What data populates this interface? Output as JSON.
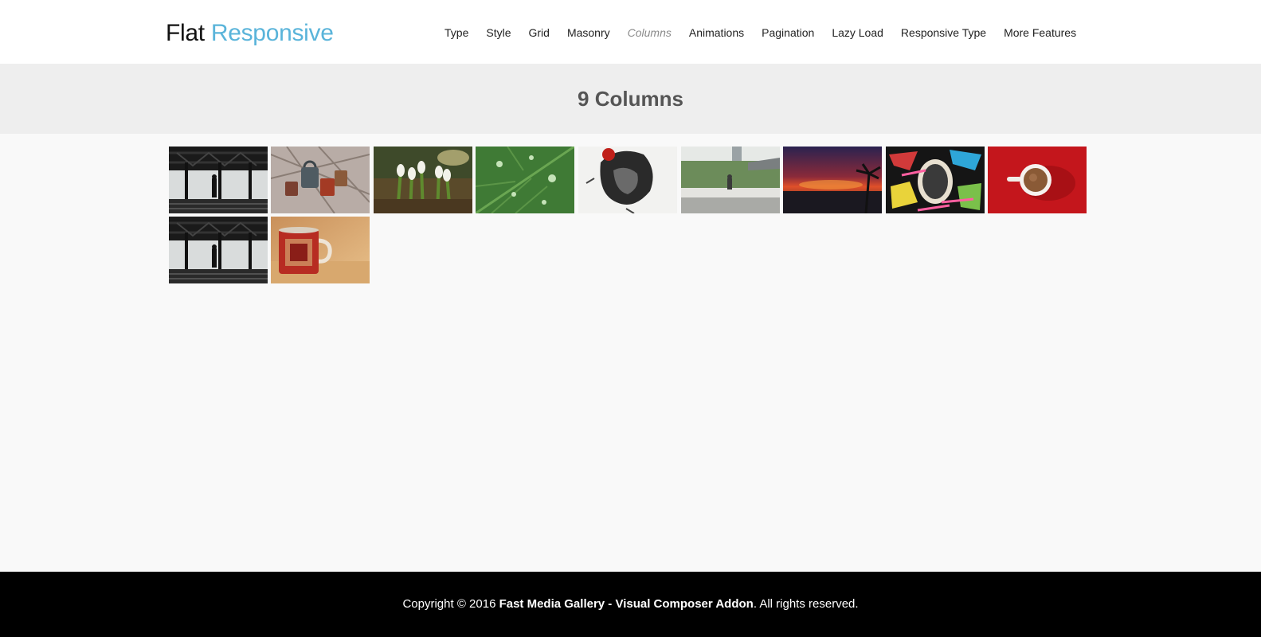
{
  "brand": {
    "part1": "Flat",
    "part2": "Responsive"
  },
  "nav": {
    "items": [
      "Type",
      "Style",
      "Grid",
      "Masonry",
      "Columns",
      "Animations",
      "Pagination",
      "Lazy Load",
      "Responsive Type",
      "More Features"
    ],
    "active": "Columns"
  },
  "banner": {
    "title": "9 Columns"
  },
  "gallery": {
    "columns": 9,
    "images": [
      "silhouette-window-photo",
      "love-locks-photo",
      "snowdrop-flowers-photo",
      "leaf-raindrops-photo",
      "ink-portrait-photo",
      "riverside-sitting-man-photo",
      "sunset-palm-photo",
      "graffiti-wall-photo",
      "coffee-cup-red-photo",
      "silhouette-window-photo",
      "red-mug-photo"
    ]
  },
  "footer": {
    "prefix": "Copyright © 2016 ",
    "strong": "Fast Media Gallery - Visual Composer Addon",
    "suffix": ". All rights reserved."
  }
}
